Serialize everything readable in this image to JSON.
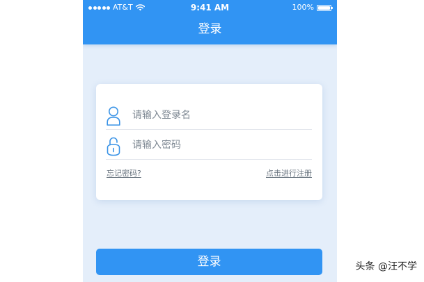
{
  "status_bar": {
    "carrier": "AT&T",
    "time": "9:41 AM",
    "battery": "100%",
    "battery_level": 1.0,
    "signal_icon": "signal-dots-icon",
    "wifi_icon": "wifi-icon"
  },
  "nav": {
    "title": "登录"
  },
  "form": {
    "username": {
      "value": "",
      "placeholder": "请输入登录名",
      "icon": "user-icon"
    },
    "password": {
      "value": "",
      "placeholder": "请输入密码",
      "icon": "lock-icon"
    },
    "forgot_label": "忘记密码?",
    "register_label": "点击进行注册"
  },
  "login_button": {
    "label": "登录"
  },
  "watermark": "头条 @汪不学",
  "colors": {
    "primary": "#3194f3",
    "background": "#e4eefa",
    "card": "#ffffff",
    "icon": "#3a93e6",
    "link": "#6a7580"
  }
}
